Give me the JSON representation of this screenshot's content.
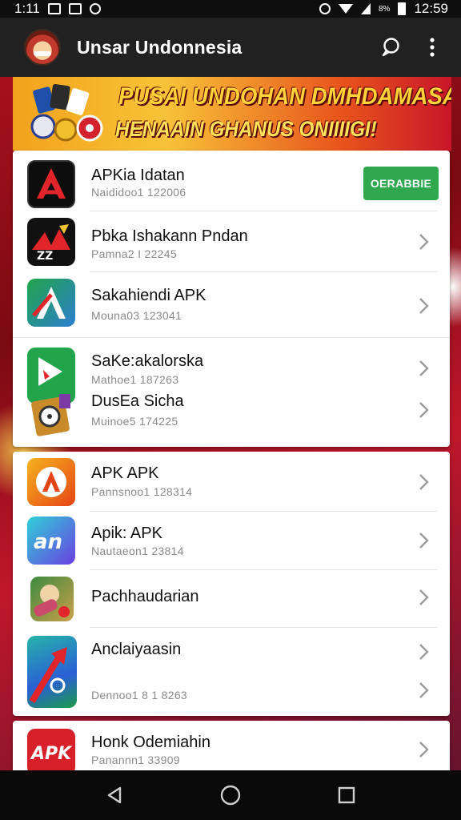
{
  "status_bar": {
    "time_left": "1:11",
    "battery_percent": "8%",
    "time_right": "12:59"
  },
  "app_bar": {
    "title": "Unsar Undonnesia",
    "icons": [
      "chat-bubble-icon",
      "more-vert-icon"
    ]
  },
  "banner": {
    "line1": "PUSAI UNDOHAN DMHDAMASAN",
    "line2": "HENAAIN GHANUS ONIIIIGI!"
  },
  "colors": {
    "accent_green": "#2fa84f",
    "app_bar": "#212121",
    "banner_yellow": "#ffd23a"
  },
  "card1": {
    "items": [
      {
        "name": "APKia Idatan",
        "sub": "Naididoo1 122006",
        "action": "OERABBIE",
        "icon": "apk-a-icon"
      },
      {
        "name": "Pbka Ishakann Pndan",
        "sub": "Pamna2 I 22245",
        "icon": "fire-app-icon"
      },
      {
        "name": "Sakahiendi APK",
        "sub": "Mouna03 123041",
        "icon": "green-a-icon"
      },
      {
        "name": "SaKe:akalorska",
        "sub": "Mathoe1 187263",
        "icon": "play-flag-icon"
      },
      {
        "name": "DusEa Sicha",
        "sub": "Muinoe5 174225",
        "icon": "box-wheel-icon"
      }
    ]
  },
  "card2": {
    "items": [
      {
        "name": "APK APK",
        "sub": "Pannsnoo1 128314",
        "icon": "orange-a-icon"
      },
      {
        "name": "Apik: APK",
        "sub": "Nautaeon1 23814",
        "icon": "an-logo-icon"
      },
      {
        "name": "Pachhaudarian",
        "sub": "",
        "icon": "game-character-icon"
      },
      {
        "name": "Anclaiyaasin",
        "sub": "Dennoo1 8 1 8263",
        "icon": "red-arrow-icon"
      }
    ]
  },
  "card3": {
    "items": [
      {
        "name": "Honk Odemiahin",
        "sub": "Panannn1 33909",
        "icon": "apk-red-icon"
      }
    ]
  },
  "nav_bar": {
    "icons": [
      "back-icon",
      "home-icon",
      "recents-icon"
    ]
  }
}
